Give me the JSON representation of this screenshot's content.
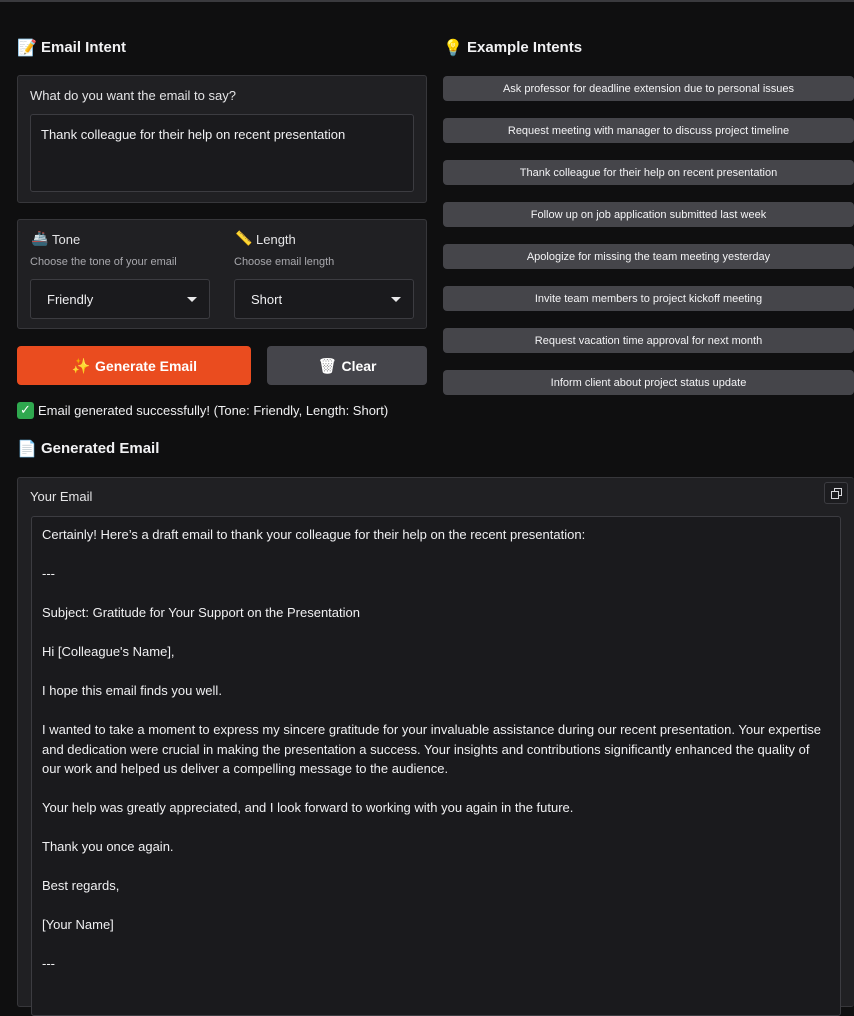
{
  "intent_section": {
    "title": "Email Intent",
    "icon": "memo-icon",
    "prompt_label": "What do you want the email to say?",
    "prompt_value": "Thank colleague for their help on recent presentation"
  },
  "tone": {
    "label": "Tone",
    "icon": "sextant-icon",
    "description": "Choose the tone of your email",
    "value": "Friendly"
  },
  "length": {
    "label": "Length",
    "icon": "ruler-icon",
    "description": "Choose email length",
    "value": "Short"
  },
  "buttons": {
    "generate_label": "Generate Email",
    "generate_icon": "sparkles-icon",
    "clear_label": "Clear",
    "clear_icon": "wastebasket-icon",
    "accent_color": "#ea4c1f"
  },
  "examples_section": {
    "title": "Example Intents",
    "icon": "lightbulb-icon",
    "items": [
      "Ask professor for deadline extension due to personal issues",
      "Request meeting with manager to discuss project timeline",
      "Thank colleague for their help on recent presentation",
      "Follow up on job application submitted last week",
      "Apologize for missing the team meeting yesterday",
      "Invite team members to project kickoff meeting",
      "Request vacation time approval for next month",
      "Inform client about project status update"
    ]
  },
  "status": {
    "icon": "check-mark-icon",
    "text": "Email generated successfully! (Tone: Friendly, Length: Short)"
  },
  "output_section": {
    "title": "Generated Email",
    "icon": "document-icon",
    "box_label": "Your Email",
    "paragraphs": [
      "Certainly! Here’s a draft email to thank your colleague for their help on the recent presentation:",
      "---",
      "Subject: Gratitude for Your Support on the Presentation",
      "Hi [Colleague's Name],",
      "I hope this email finds you well.",
      "I wanted to take a moment to express my sincere gratitude for your invaluable assistance during our recent presentation. Your expertise and dedication were crucial in making the presentation a success. Your insights and contributions significantly enhanced the quality of our work and helped us deliver a compelling message to the audience.",
      "Your help was greatly appreciated, and I look forward to working with you again in the future.",
      "Thank you once again.",
      "Best regards,",
      "[Your Name]",
      "---"
    ]
  }
}
